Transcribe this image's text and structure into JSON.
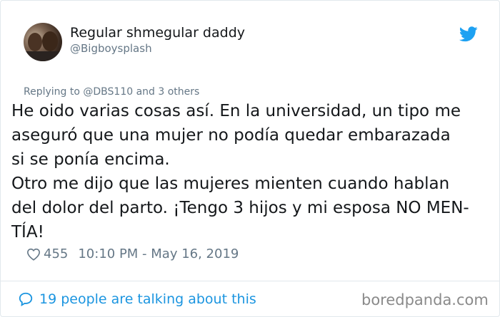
{
  "user": {
    "display_name": "Regular shmegular daddy",
    "handle": "@Bigboysplash"
  },
  "reply": {
    "prefix": "Replying to",
    "mention": "@DBS110",
    "suffix": "and 3 others"
  },
  "tweet": {
    "lines": [
      "He oido varias cosas así. En la universidad, un tipo me",
      "aseguró que una mujer no podía quedar embarazada",
      "si se ponía encima.",
      "Otro me dijo que las mujeres mienten cuando hablan",
      "del dolor del parto. ¡Tengo 3 hijos y mi esposa NO MEN-",
      "TÍA!"
    ]
  },
  "meta": {
    "likes": "455",
    "timestamp": "10:10 PM - May 16, 2019"
  },
  "footer": {
    "talking": "19 people are talking about this",
    "brand": "boredpanda.com"
  },
  "icons": {
    "bird": "twitter-bird-icon",
    "heart": "heart-icon",
    "bubble": "comment-bubble-icon"
  },
  "colors": {
    "accent": "#1b95e0",
    "muted": "#657786",
    "text": "#14171a"
  }
}
